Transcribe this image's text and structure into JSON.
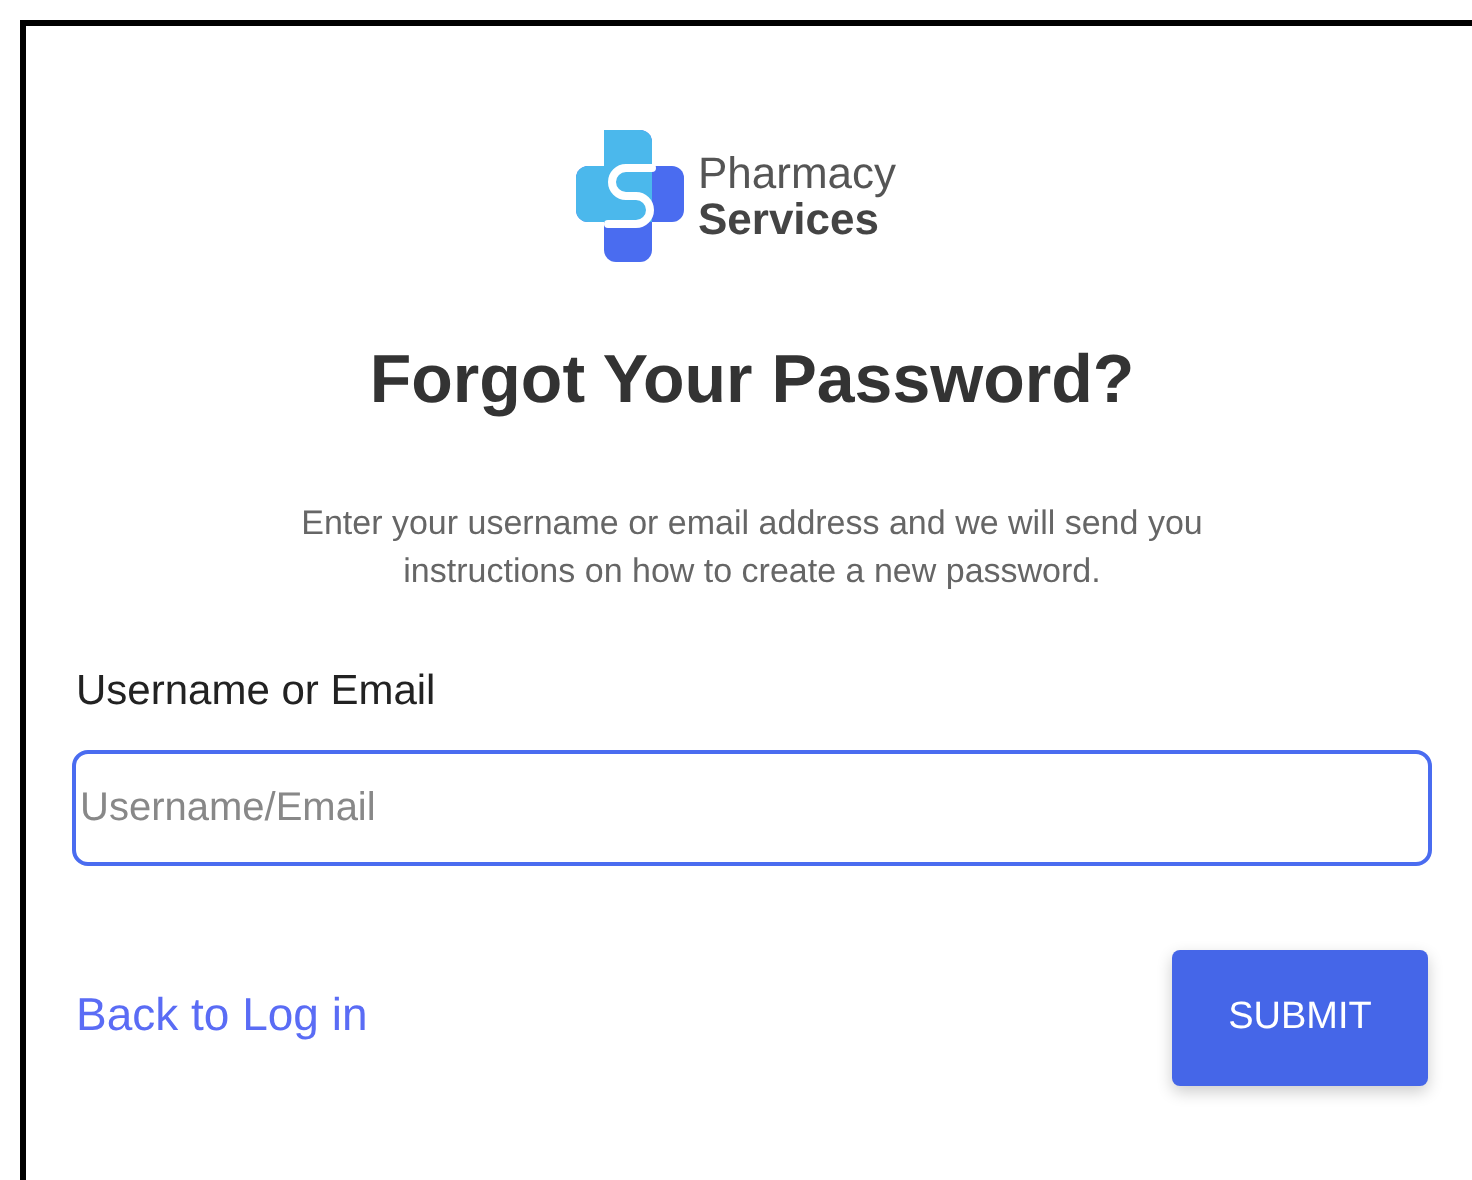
{
  "logo": {
    "line_1": "Pharmacy",
    "line_2": "Services"
  },
  "title": "Forgot Your Password?",
  "description": "Enter your username or email address and we will send you instructions on how to create a new password.",
  "field": {
    "label": "Username or Email",
    "placeholder": "Username/Email",
    "focused": true
  },
  "back_link": "Back to Log in",
  "submit_button": "SUBMIT"
}
